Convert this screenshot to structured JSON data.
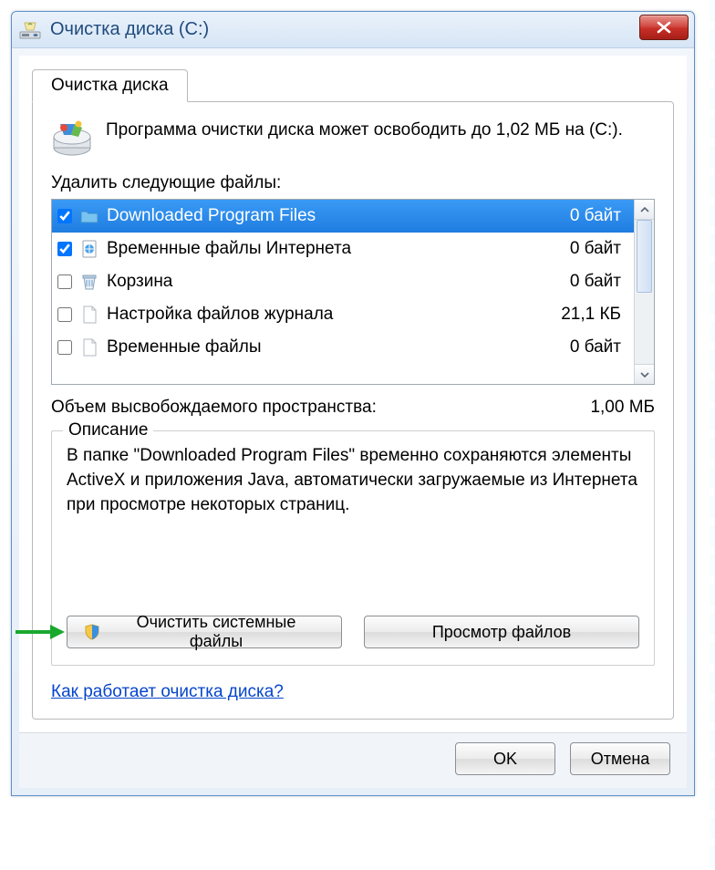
{
  "window": {
    "title": "Очистка диска  (C:)",
    "tab_label": "Очистка диска",
    "summary": "Программа очистки диска может освободить до 1,02 МБ на  (C:).",
    "files_label": "Удалить следующие файлы:",
    "total_label": "Объем высвобождаемого пространства:",
    "total_value": "1,00 МБ",
    "desc_legend": "Описание",
    "desc_text": "В папке \"Downloaded Program Files\" временно сохраняются элементы ActiveX и приложения Java, автоматически загружаемые из Интернета при просмотре некоторых страниц.",
    "btn_clean_system": "Очистить системные файлы",
    "btn_view_files": "Просмотр файлов",
    "link_help": "Как работает очистка диска?",
    "btn_ok": "OK",
    "btn_cancel": "Отмена"
  },
  "files": [
    {
      "name": "Downloaded Program Files",
      "size": "0 байт",
      "checked": true,
      "selected": true,
      "icon": "folder-blue"
    },
    {
      "name": "Временные файлы Интернета",
      "size": "0 байт",
      "checked": true,
      "selected": false,
      "icon": "page-globe"
    },
    {
      "name": "Корзина",
      "size": "0 байт",
      "checked": false,
      "selected": false,
      "icon": "recycle-bin"
    },
    {
      "name": "Настройка файлов журнала",
      "size": "21,1 КБ",
      "checked": false,
      "selected": false,
      "icon": "page"
    },
    {
      "name": "Временные файлы",
      "size": "0 байт",
      "checked": false,
      "selected": false,
      "icon": "page"
    }
  ]
}
